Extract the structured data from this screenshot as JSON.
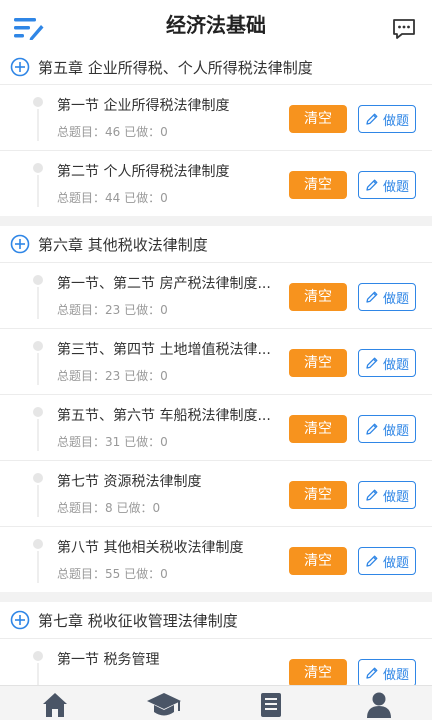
{
  "header": {
    "title": "经济法基础"
  },
  "chapters": [
    {
      "title": "第五章 企业所得税、个人所得税法律制度",
      "sections": [
        {
          "name": "第一节 企业所得税法律制度",
          "meta": "总题目：46 已做：0"
        },
        {
          "name": "第二节 个人所得税法律制度",
          "meta": "总题目：44 已做：0"
        }
      ]
    },
    {
      "title": "第六章 其他税收法律制度",
      "sections": [
        {
          "name": "第一节、第二节 房产税法律制度...",
          "meta": "总题目：23 已做：0"
        },
        {
          "name": "第三节、第四节 土地增值税法律...",
          "meta": "总题目：23 已做：0"
        },
        {
          "name": "第五节、第六节 车船税法律制度...",
          "meta": "总题目：31 已做：0"
        },
        {
          "name": "第七节 资源税法律制度",
          "meta": "总题目：8 已做：0"
        },
        {
          "name": "第八节 其他相关税收法律制度",
          "meta": "总题目：55 已做：0"
        }
      ]
    },
    {
      "title": "第七章 税收征收管理法律制度",
      "sections": [
        {
          "name": "第一节 税务管理",
          "meta": ""
        }
      ]
    }
  ],
  "buttons": {
    "clear_label": "清空",
    "do_label": "做题"
  },
  "colors": {
    "accent_blue": "#2f86e6",
    "clear_orange": "#f7931e"
  },
  "icons": {
    "header_left": "menu-lines-icon",
    "header_right": "message-icon",
    "chapter": "plus-circle-icon",
    "do_button": "pencil-icon",
    "tabs": [
      "home-icon",
      "graduation-cap-icon",
      "book-icon",
      "user-icon"
    ]
  }
}
